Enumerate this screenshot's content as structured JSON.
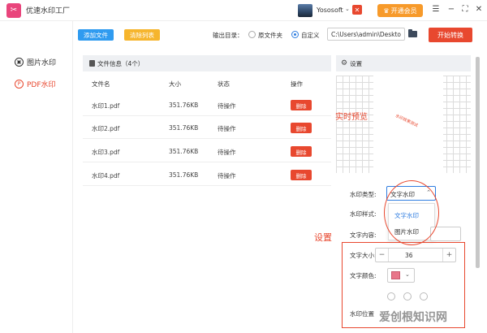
{
  "app": {
    "title": "优速水印工厂",
    "logo_glyph": "✂"
  },
  "user": {
    "name": "Yososoft"
  },
  "titlebar": {
    "vip_label": "开通会员",
    "vip_x": "✕",
    "menu": "☰",
    "minimize": "−",
    "maximize": "⛶",
    "close": "✕"
  },
  "sidebar": {
    "items": [
      {
        "label": "图片水印",
        "icon": "image-icon",
        "active": false
      },
      {
        "label": "PDF水印",
        "icon": "pdf-icon",
        "active": true
      }
    ]
  },
  "toolbar": {
    "add_files": "添加文件",
    "clear_list": "清除列表",
    "output_label": "输出目录：",
    "option_original": "原文件夹",
    "option_custom": "自定义",
    "selected_option": "自定义",
    "path_value": "C:\\Users\\admin\\Deskto",
    "start": "开始转换"
  },
  "files": {
    "header": "文件信息（4个）",
    "columns": [
      "文件名",
      "大小",
      "状态",
      "操作"
    ],
    "rows": [
      {
        "name": "水印1.pdf",
        "size": "351.76KB",
        "status": "待操作",
        "action": "删除"
      },
      {
        "name": "水印2.pdf",
        "size": "351.76KB",
        "status": "待操作",
        "action": "删除"
      },
      {
        "name": "水印3.pdf",
        "size": "351.76KB",
        "status": "待操作",
        "action": "删除"
      },
      {
        "name": "水印4.pdf",
        "size": "351.76KB",
        "status": "待操作",
        "action": "删除"
      }
    ]
  },
  "settings": {
    "header": "设置",
    "preview_overlay": "实时预览",
    "preview_watermark": "水印效果测试",
    "type_label": "水印类型:",
    "type_value": "文字水印",
    "type_options": [
      "文字水印",
      "图片水印"
    ],
    "style_label": "水印样式:",
    "content_label": "文字内容:",
    "size_label": "文字大小:",
    "size_value": "36",
    "color_label": "文字颜色:",
    "color_value": "#e8768a",
    "position_label": "水印位置",
    "annotation": "设置"
  },
  "brand_watermark": "爱创根知识网",
  "colors": {
    "accent_red": "#e8482f",
    "blue": "#2f9bf0",
    "orange": "#f6b52d"
  }
}
